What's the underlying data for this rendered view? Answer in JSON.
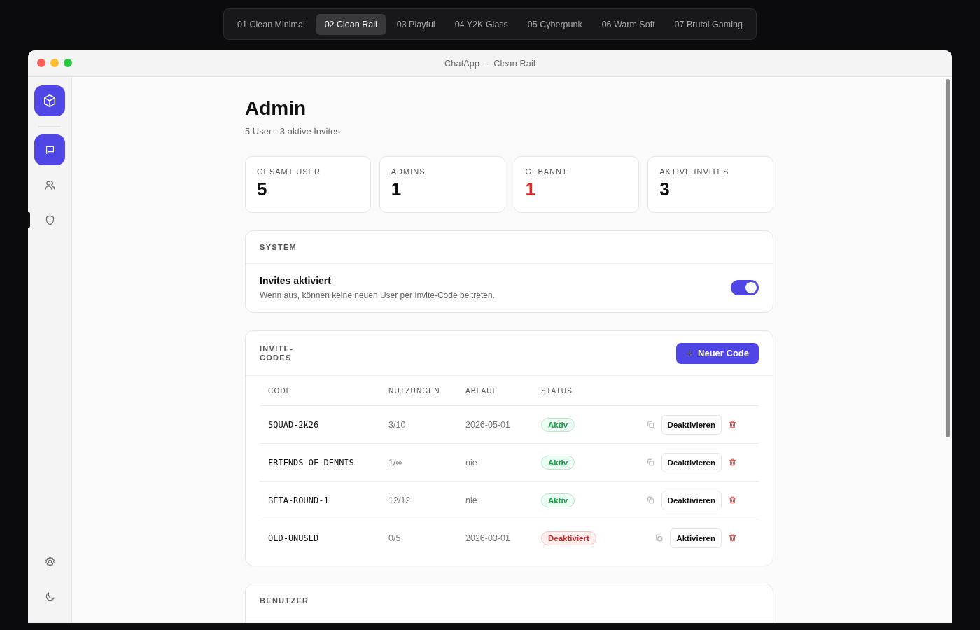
{
  "theme_tabs": [
    {
      "label": "01 Clean Minimal",
      "selected": false
    },
    {
      "label": "02 Clean Rail",
      "selected": true
    },
    {
      "label": "03 Playful",
      "selected": false
    },
    {
      "label": "04 Y2K Glass",
      "selected": false
    },
    {
      "label": "05 Cyberpunk",
      "selected": false
    },
    {
      "label": "06 Warm Soft",
      "selected": false
    },
    {
      "label": "07 Brutal Gaming",
      "selected": false
    }
  ],
  "window": {
    "title": "ChatApp — Clean Rail"
  },
  "rail": {
    "items": [
      {
        "kind": "chat",
        "highlighted": true,
        "selected": false
      },
      {
        "kind": "users",
        "highlighted": false,
        "selected": false
      },
      {
        "kind": "shield",
        "highlighted": false,
        "selected": true
      }
    ],
    "bottom": [
      {
        "kind": "settings"
      },
      {
        "kind": "moon"
      }
    ]
  },
  "page": {
    "title": "Admin",
    "subtitle": "5 User · 3 aktive Invites"
  },
  "stats": [
    {
      "label": "GESAMT USER",
      "value": "5",
      "alert": false
    },
    {
      "label": "ADMINS",
      "value": "1",
      "alert": false
    },
    {
      "label": "GEBANNT",
      "value": "1",
      "alert": true
    },
    {
      "label": "AKTIVE INVITES",
      "value": "3",
      "alert": false
    }
  ],
  "system": {
    "heading": "SYSTEM",
    "setting": {
      "label": "Invites aktiviert",
      "description": "Wenn aus, können keine neuen User per Invite-Code beitreten.",
      "on": true
    }
  },
  "invites": {
    "heading": "INVITE-CODES",
    "new_button": "Neuer Code",
    "columns": [
      "CODE",
      "NUTZUNGEN",
      "ABLAUF",
      "STATUS"
    ],
    "rows": [
      {
        "code": "SQUAD-2k26",
        "uses": "3/10",
        "expiry": "2026-05-01",
        "status": {
          "label": "Aktiv",
          "kind": "active"
        },
        "action": "Deaktivieren"
      },
      {
        "code": "FRIENDS-OF-DENNIS",
        "uses": "1/∞",
        "expiry": "nie",
        "status": {
          "label": "Aktiv",
          "kind": "active"
        },
        "action": "Deaktivieren"
      },
      {
        "code": "BETA-ROUND-1",
        "uses": "12/12",
        "expiry": "nie",
        "status": {
          "label": "Aktiv",
          "kind": "active"
        },
        "action": "Deaktivieren"
      },
      {
        "code": "OLD-UNUSED",
        "uses": "0/5",
        "expiry": "2026-03-01",
        "status": {
          "label": "Deaktiviert",
          "kind": "inactive"
        },
        "action": "Aktivieren"
      }
    ]
  },
  "users": {
    "heading": "BENUTZER"
  }
}
